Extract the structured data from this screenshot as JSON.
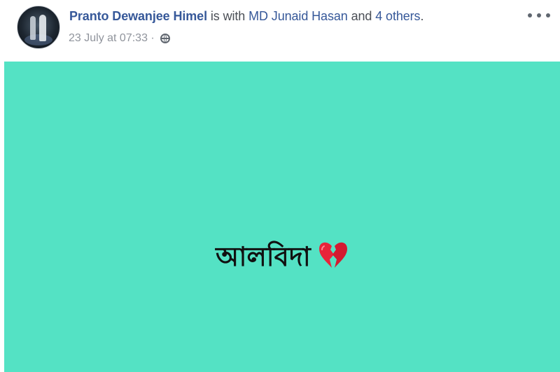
{
  "post": {
    "author": "Pranto Dewanjee Himel",
    "is_with_text": " is with ",
    "tagged_name": "MD Junaid Hasan",
    "and_text": " and ",
    "others_text": "4 others",
    "period": ".",
    "timestamp": "23 July at 07:33",
    "separator": " · ",
    "privacy_icon": "globe-icon",
    "more_icon": "more-options-icon",
    "status_text": "আলবিদা",
    "status_emoji": "broken-heart-icon",
    "background_color": "#54e2c4"
  }
}
